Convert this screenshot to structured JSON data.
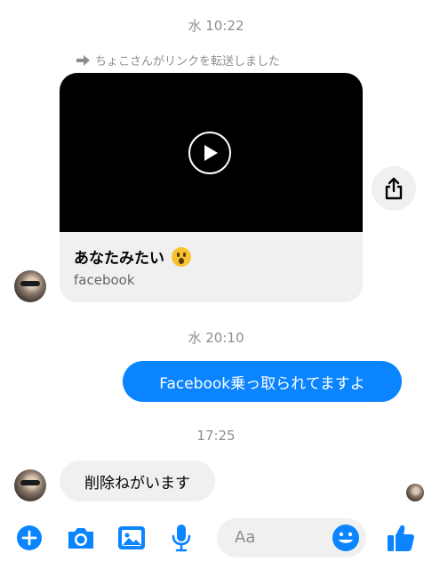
{
  "thread": {
    "timestamp_1": "水 10:22",
    "forward_notice": "ちょこさんがリンクを転送しました",
    "shared_link": {
      "title": "あなたみたい",
      "source": "facebook"
    },
    "timestamp_2": "水 20:10",
    "outgoing_message": "Facebook乗っ取られてますよ",
    "timestamp_3": "17:25",
    "incoming_message": "削除ねがいます"
  },
  "composer": {
    "placeholder": "Aa"
  },
  "colors": {
    "accent": "#0a84ff",
    "bubble_gray": "#f0f0f0",
    "meta_gray": "#8a8d91"
  },
  "icons": [
    "forward-arrow-icon",
    "play-icon",
    "share-icon",
    "plus-icon",
    "camera-icon",
    "image-icon",
    "microphone-icon",
    "emoji-icon",
    "thumbs-up-icon"
  ]
}
